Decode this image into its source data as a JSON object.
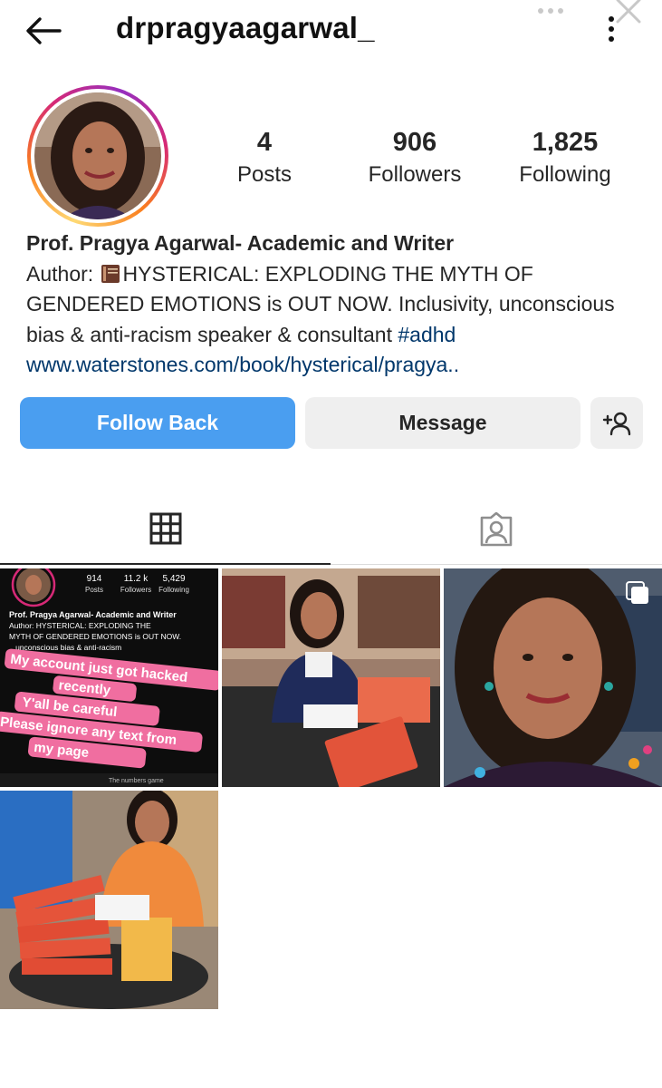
{
  "header": {
    "username": "drpragyaagarwal_",
    "back_icon": "arrow-left-icon",
    "menu_icon": "more-vertical-icon"
  },
  "stats": {
    "posts_count": "4",
    "posts_label": "Posts",
    "followers_count": "906",
    "followers_label": "Followers",
    "following_count": "1,825",
    "following_label": "Following"
  },
  "bio": {
    "name": "Prof. Pragya Agarwal- Academic and Writer",
    "line1_prefix": "Author: ",
    "line1_text": "HYSTERICAL: EXPLODING THE MYTH OF",
    "line2": "GENDERED EMOTIONS is OUT NOW. Inclusivity, unconscious",
    "line3_text": "bias & anti-racism speaker & consultant ",
    "hashtag": "#adhd",
    "link": "www.waterstones.com/book/hysterical/pragya.."
  },
  "actions": {
    "follow_back": "Follow Back",
    "message": "Message",
    "add_user_icon": "add-person-icon"
  },
  "tabs": {
    "grid_icon": "grid-icon",
    "tagged_icon": "tagged-person-icon"
  },
  "posts": [
    {
      "kind": "screenshot",
      "mini_stats": [
        "914",
        "11.2 k",
        "5,429"
      ],
      "mini_labels": [
        "Posts",
        "Followers",
        "Following"
      ],
      "mini_name": "Prof. Pragya Agarwal- Academic and Writer",
      "mini_bio1": "Author: HYSTERICAL: EXPLODING THE",
      "mini_bio2": "MYTH OF GENDERED EMOTIONS is OUT NOW.",
      "mini_bio3": "...unconscious bias & anti-racism",
      "overlay1": "My account just got hacked",
      "overlay2": "recently",
      "overlay3": "Y'all be careful",
      "overlay4": "Please ignore any text from",
      "overlay5": "my page",
      "mini_footer": "The numbers game"
    },
    {
      "kind": "book-signing"
    },
    {
      "kind": "selfie",
      "multi": true
    },
    {
      "kind": "book-stack"
    }
  ],
  "colors": {
    "follow_button": "#4a9ef0",
    "secondary_button": "#efefef",
    "link": "#00376b"
  }
}
